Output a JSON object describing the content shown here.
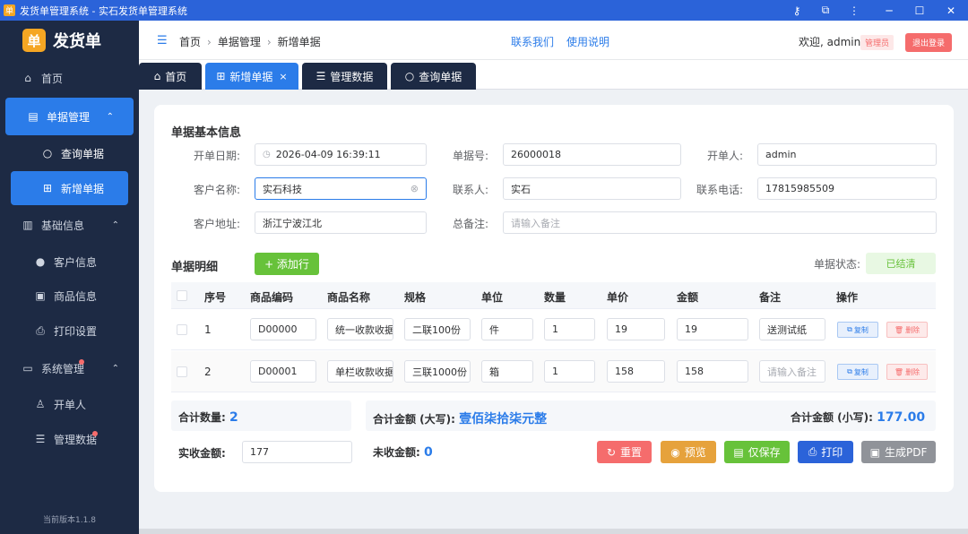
{
  "window": {
    "title": "发货单管理系统 - 实石发货单管理系统",
    "icon_char": "单"
  },
  "brand": {
    "name": "发货单",
    "icon_char": "单"
  },
  "sidebar": {
    "home": "首页",
    "doc_mgmt": "单据管理",
    "query": "查询单据",
    "new": "新增单据",
    "basic": "基础信息",
    "customer": "客户信息",
    "product": "商品信息",
    "print": "打印设置",
    "sys": "系统管理",
    "issuer": "开单人",
    "data": "管理数据",
    "version": "当前版本1.1.8"
  },
  "header": {
    "breadcrumb": [
      "首页",
      "单据管理",
      "新增单据"
    ],
    "contact": "联系我们",
    "manual": "使用说明",
    "welcome": "欢迎, admin",
    "role": "管理员",
    "logout": "退出登录"
  },
  "tabs": [
    {
      "label": "首页"
    },
    {
      "label": "新增单据",
      "close": "×"
    },
    {
      "label": "管理数据"
    },
    {
      "label": "查询单据"
    }
  ],
  "form": {
    "section_title": "单据基本信息",
    "date_label": "开单日期:",
    "date_value": "2026-04-09 16:39:11",
    "no_label": "单据号:",
    "no_value": "26000018",
    "issuer_label": "开单人:",
    "issuer_value": "admin",
    "customer_label": "客户名称:",
    "customer_value": "实石科技",
    "contact_label": "联系人:",
    "contact_value": "实石",
    "phone_label": "联系电话:",
    "phone_value": "17815985509",
    "address_label": "客户地址:",
    "address_value": "浙江宁波江北",
    "remark_label": "总备注:",
    "remark_placeholder": "请输入备注"
  },
  "detail": {
    "title": "单据明细",
    "add_row": "+ 添加行",
    "status_label": "单据状态:",
    "status_value": "已结清",
    "columns": [
      "序号",
      "商品编码",
      "商品名称",
      "规格",
      "单位",
      "数量",
      "单价",
      "金额",
      "备注",
      "操作"
    ],
    "rows": [
      {
        "no": "1",
        "code": "D00000",
        "name": "统一收款收据",
        "spec": "二联100份",
        "unit": "件",
        "qty": "1",
        "price": "19",
        "amount": "19",
        "remark": "送测试纸",
        "remark_placeholder": ""
      },
      {
        "no": "2",
        "code": "D00001",
        "name": "单栏收款收据",
        "spec": "三联1000份",
        "unit": "箱",
        "qty": "1",
        "price": "158",
        "amount": "158",
        "remark": "",
        "remark_placeholder": "请输入备注"
      }
    ],
    "copy": "复制",
    "delete": "删除"
  },
  "summary": {
    "qty_label": "合计数量:",
    "qty_value": "2",
    "upper_label": "合计金额 (大写):",
    "upper_value": "壹佰柒拾柒元整",
    "lower_label": "合计金额 (小写):",
    "lower_value": "177.00",
    "received_label": "实收金额:",
    "received_value": "177",
    "unpaid_label": "未收金额:",
    "unpaid_value": "0"
  },
  "actions": {
    "reset": "重置",
    "preview": "预览",
    "save": "仅保存",
    "print": "打印",
    "pdf": "生成PDF"
  },
  "colors": {
    "accent": "#2b7ce9",
    "sidebar": "#1d2a44",
    "danger": "#f56c6c",
    "warning": "#e6a23c",
    "success": "#67c23a",
    "gray": "#909399"
  }
}
